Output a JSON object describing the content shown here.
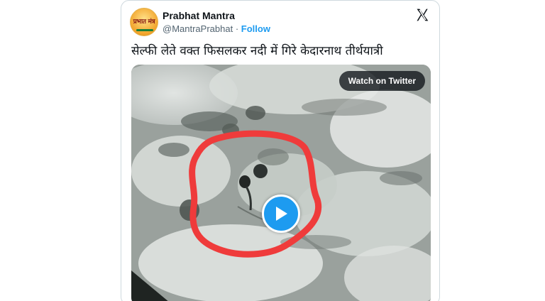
{
  "tweet": {
    "author_name": "Prabhat Mantra",
    "handle": "@MantraPrabhat",
    "separator": "·",
    "follow_label": "Follow",
    "text": "सेल्फी लेते वक्त फिसलकर नदी में गिरे केदारनाथ तीर्थयात्री",
    "avatar_text": "प्रभात मंत्र"
  },
  "media": {
    "watch_label": "Watch on Twitter",
    "play_icon": "play-icon"
  },
  "colors": {
    "accent": "#1d9bf0",
    "annotation_circle": "#ef3b3b",
    "text_primary": "#0f1419",
    "text_secondary": "#536471"
  }
}
